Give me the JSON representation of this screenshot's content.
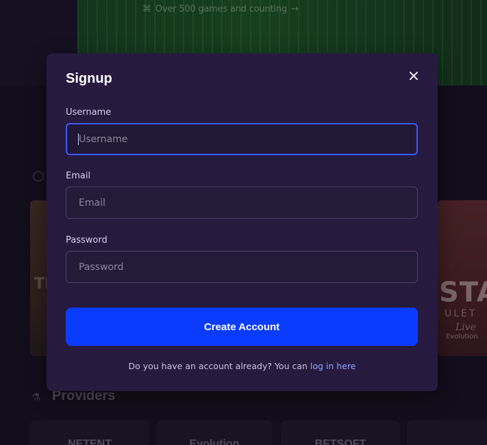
{
  "background": {
    "banner_text": "Over 500 games and counting",
    "section_title": "Providers",
    "provider_cards": [
      "NETENT",
      "Evolution",
      "BETSOFT",
      ""
    ],
    "game_card_right": {
      "title": "STA",
      "subtitle": "ULET",
      "tag": "Live",
      "provider": "Evolution"
    },
    "game_card_left": {
      "ghost_text": "TI"
    }
  },
  "modal": {
    "title": "Signup",
    "close_icon": "close-icon",
    "fields": [
      {
        "label": "Username",
        "placeholder": "Username",
        "value": "",
        "focused": true
      },
      {
        "label": "Email",
        "placeholder": "Email",
        "value": ""
      },
      {
        "label": "Password",
        "placeholder": "Password",
        "value": ""
      }
    ],
    "submit_label": "Create Account",
    "footer_text": "Do you have an account already? You can ",
    "footer_link": "log in here"
  },
  "colors": {
    "modal_bg": "#271a3f",
    "accent": "#0a3cff",
    "link": "#8fa6ff",
    "focus_border": "#3b5bff"
  }
}
